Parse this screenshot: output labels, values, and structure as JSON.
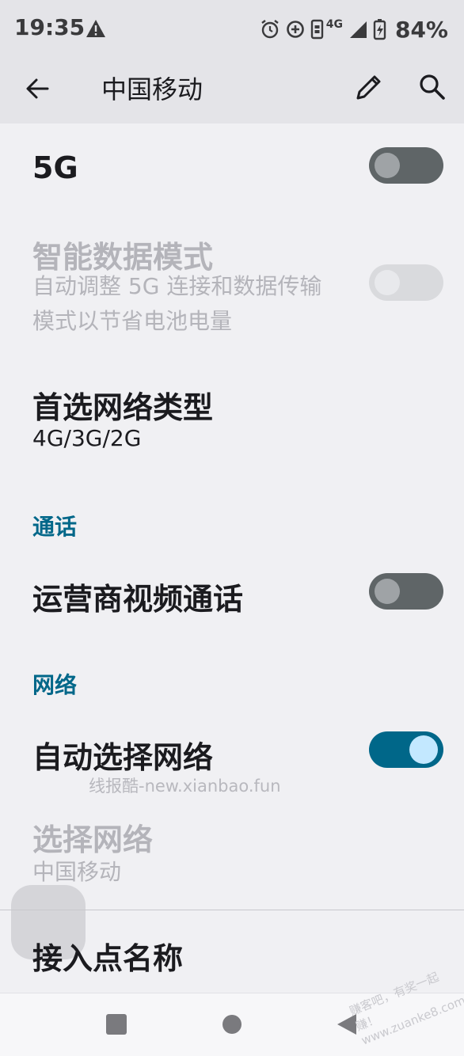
{
  "status_bar": {
    "time": "19:35",
    "network_label": "4G",
    "battery": "84%",
    "icons": [
      "warning-icon",
      "alarm-icon",
      "data-saver-icon",
      "sim-icon",
      "signal-icon",
      "battery-charging-icon"
    ]
  },
  "app_bar": {
    "title": "中国移动",
    "back_icon": "arrow-back-icon",
    "edit_icon": "pencil-icon",
    "search_icon": "search-icon"
  },
  "settings": {
    "five_g": {
      "title": "5G",
      "enabled": false
    },
    "smart_data": {
      "title": "智能数据模式",
      "subtitle_line1": "自动调整 5G 连接和数据传输",
      "subtitle_line2": "模式以节省电池电量",
      "enabled": false,
      "disabled": true
    },
    "preferred_network": {
      "title": "首选网络类型",
      "value": "4G/3G/2G"
    },
    "calls_header": "通话",
    "video_calling": {
      "title": "运营商视频通话",
      "enabled": false
    },
    "network_header": "网络",
    "auto_select": {
      "title": "自动选择网络",
      "enabled": true
    },
    "choose_network": {
      "title": "选择网络",
      "value": "中国移动",
      "disabled": true
    },
    "apn": {
      "title": "接入点名称"
    }
  },
  "watermark": "线报酷-new.xianbao.fun",
  "corner_watermark": "赚客吧，有奖一起赚！ www.zuanke8.com",
  "colors": {
    "accent": "#006789",
    "switch_off": "#5f6567",
    "switch_on_thumb": "#c3e8ff",
    "disabled_text": "#b4b4ba"
  }
}
